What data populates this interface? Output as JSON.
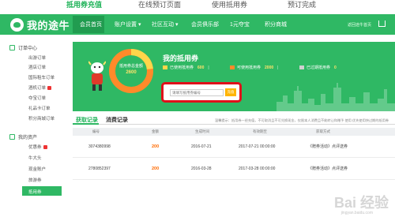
{
  "steps": [
    "抵用券充值",
    "在线预订页面",
    "使用抵用券",
    "预订完成"
  ],
  "brand": {
    "name": "我的途牛",
    "accent": "#2fb864"
  },
  "nav": [
    "会员首页",
    "账户设置 ▾",
    "社区互动 ▾",
    "会员俱乐部",
    "1元夺宝",
    "积分商城"
  ],
  "header_right": "返回途牛首页",
  "sidebar": {
    "group1": "订单中心",
    "orders": [
      "出游订单",
      "酒店订单",
      "国际租车订单",
      "酒机订单",
      "夺宝订单",
      "礼品卡订单",
      "积分商城订单"
    ],
    "orders_badge_index": 3,
    "group2": "我的资产",
    "assets": [
      "优惠券",
      "牛大头",
      "现金账户",
      "旅游券",
      "抵用券"
    ],
    "assets_badge_index": 0,
    "active": "抵用券"
  },
  "banner": {
    "donut_label": "抵用券总金额",
    "donut_value": "2600",
    "title": "我的抵用券",
    "stats": [
      {
        "label": "已使用抵用券",
        "value": "600",
        "color": "#ffd54a"
      },
      {
        "label": "可使用抵用券",
        "value": "2000",
        "color": "#ff8a2a"
      },
      {
        "label": "已过期抵用券",
        "value": "0",
        "color": "#d0d0d0"
      }
    ],
    "search_placeholder": "请填写抵用券编号",
    "search_button": "充值"
  },
  "tabs": [
    "获取记录",
    "消费记录"
  ],
  "tip": "温馨提示：抵用券一经充值，不可取消且不可兑换现金，仅限本人消费且不能转让和赠予 使用  优先使用快过期的抵用券",
  "table": {
    "headers": [
      "编号",
      "金额",
      "生成时间",
      "有效期至",
      "获取方式"
    ],
    "rows": [
      {
        "id": "3074380998",
        "amount": "200",
        "created": "2016-07-21",
        "expires": "2017-07-21 00:00:00",
        "source": "《赠券活动》点评送券"
      },
      {
        "id": "2780852397",
        "amount": "200",
        "created": "2016-03-28",
        "expires": "2017-03-28 00:00:00",
        "source": "《赠券活动》点评送券"
      }
    ]
  },
  "watermark": "Bai 经验",
  "watermark_sub": "jingyan.baidu.com"
}
